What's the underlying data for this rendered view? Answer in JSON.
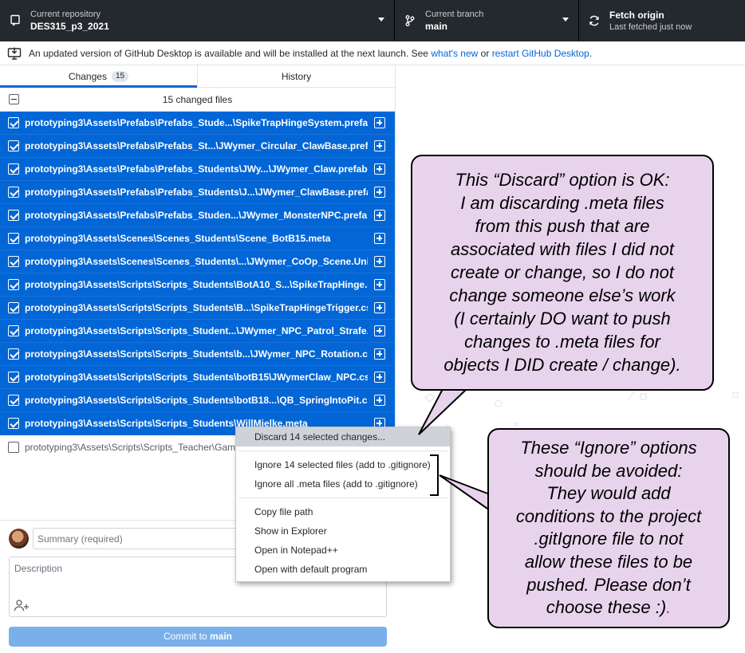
{
  "toolbar": {
    "repo_label": "Current repository",
    "repo_value": "DES315_p3_2021",
    "branch_label": "Current branch",
    "branch_value": "main",
    "fetch_label": "Fetch origin",
    "fetch_sub": "Last fetched just now"
  },
  "banner": {
    "text": "An updated version of GitHub Desktop is available and will be installed at the next launch. See",
    "link1": "what's new",
    "middle": "or",
    "link2": "restart GitHub Desktop",
    "end": "."
  },
  "tabs": {
    "changes_label": "Changes",
    "changes_count": "15",
    "history_label": "History"
  },
  "files_header": "15 changed files",
  "files": [
    "prototyping3\\Assets\\Prefabs\\Prefabs_Stude...\\SpikeTrapHingeSystem.prefab.meta",
    "prototyping3\\Assets\\Prefabs\\Prefabs_St...\\JWymer_Circular_ClawBase.prefab.meta",
    "prototyping3\\Assets\\Prefabs\\Prefabs_Students\\JWy...\\JWymer_Claw.prefab.meta",
    "prototyping3\\Assets\\Prefabs\\Prefabs_Students\\J...\\JWymer_ClawBase.prefab.meta",
    "prototyping3\\Assets\\Prefabs\\Prefabs_Studen...\\JWymer_MonsterNPC.prefab.meta",
    "prototyping3\\Assets\\Scenes\\Scenes_Students\\Scene_BotB15.meta",
    "prototyping3\\Assets\\Scenes\\Scenes_Students\\...\\JWymer_CoOp_Scene.Unity.meta",
    "prototyping3\\Assets\\Scripts\\Scripts_Students\\BotA10_S...\\SpikeTrapHinge.cs.meta",
    "prototyping3\\Assets\\Scripts\\Scripts_Students\\B...\\SpikeTrapHingeTrigger.cs.meta",
    "prototyping3\\Assets\\Scripts\\Scripts_Student...\\JWymer_NPC_Patrol_Strafe.cs.meta",
    "prototyping3\\Assets\\Scripts\\Scripts_Students\\b...\\JWymer_NPC_Rotation.cs.meta",
    "prototyping3\\Assets\\Scripts\\Scripts_Students\\botB15\\JWymerClaw_NPC.cs.meta",
    "prototyping3\\Assets\\Scripts\\Scripts_Students\\botB18...\\QB_SpringIntoPit.cs.meta",
    "prototyping3\\Assets\\Scripts\\Scripts_Students\\WillMielke.meta"
  ],
  "unselected_file": "prototyping3\\Assets\\Scripts\\Scripts_Teacher\\Gam",
  "context_menu": {
    "discard": "Discard 14 selected changes...",
    "ignore_selected": "Ignore 14 selected files (add to .gitignore)",
    "ignore_meta": "Ignore all .meta files (add to .gitignore)",
    "copy_path": "Copy file path",
    "show_explorer": "Show in Explorer",
    "open_notepad": "Open in Notepad++",
    "open_default": "Open with default program"
  },
  "commit": {
    "summary_placeholder": "Summary (required)",
    "description_placeholder": "Description",
    "button_prefix": "Commit to ",
    "button_branch": "main"
  },
  "callout_discard": {
    "lines": [
      "This “Discard” option is OK:",
      "I am discarding .meta files",
      "from this push that are",
      "associated with files I did not",
      "create or change, so I do not",
      "change someone else’s work",
      "(I certainly DO want to push",
      "changes to .meta files for",
      "objects I DID create / change)."
    ]
  },
  "callout_ignore": {
    "lines": [
      "These “Ignore” options",
      "should be avoided:",
      "They would add",
      "conditions to the project",
      ".gitIgnore file to not",
      "allow these files to be",
      "pushed. Please don’t",
      "choose these :)"
    ],
    "last_char": "."
  },
  "colors": {
    "toolbar_bg": "#24292e",
    "selected_row": "#0366d6",
    "callout_bg": "#e8d3ec",
    "commit_button": "#79b0ea"
  }
}
